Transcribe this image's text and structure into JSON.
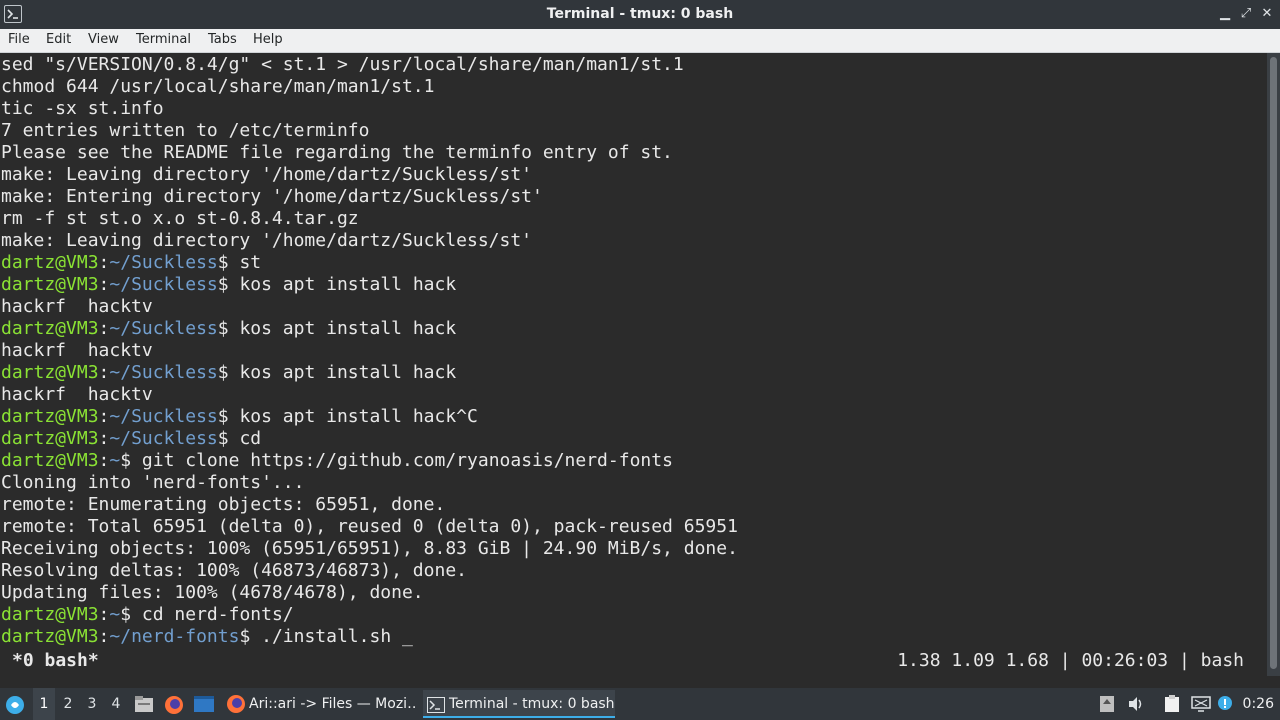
{
  "window": {
    "title": "Terminal - tmux: 0 bash",
    "minimize": "▁",
    "maximize": "⤢",
    "close": "✕"
  },
  "menu": [
    "File",
    "Edit",
    "View",
    "Terminal",
    "Tabs",
    "Help"
  ],
  "terminal": {
    "lines": [
      {
        "text": "sed \"s/VERSION/0.8.4/g\" < st.1 > /usr/local/share/man/man1/st.1"
      },
      {
        "text": "chmod 644 /usr/local/share/man/man1/st.1"
      },
      {
        "text": "tic -sx st.info"
      },
      {
        "text": "7 entries written to /etc/terminfo"
      },
      {
        "text": "Please see the README file regarding the terminfo entry of st."
      },
      {
        "text": "make: Leaving directory '/home/dartz/Suckless/st'"
      },
      {
        "text": "make: Entering directory '/home/dartz/Suckless/st'"
      },
      {
        "text": "rm -f st st.o x.o st-0.8.4.tar.gz"
      },
      {
        "text": "make: Leaving directory '/home/dartz/Suckless/st'"
      },
      {
        "user": "dartz@VM3",
        "path": "~/Suckless",
        "cmd": "$ st"
      },
      {
        "user": "dartz@VM3",
        "path": "~/Suckless",
        "cmd": "$ kos apt install hack"
      },
      {
        "text": "hackrf  hacktv"
      },
      {
        "user": "dartz@VM3",
        "path": "~/Suckless",
        "cmd": "$ kos apt install hack"
      },
      {
        "text": "hackrf  hacktv"
      },
      {
        "user": "dartz@VM3",
        "path": "~/Suckless",
        "cmd": "$ kos apt install hack"
      },
      {
        "text": "hackrf  hacktv"
      },
      {
        "user": "dartz@VM3",
        "path": "~/Suckless",
        "cmd": "$ kos apt install hack^C"
      },
      {
        "user": "dartz@VM3",
        "path": "~/Suckless",
        "cmd": "$ cd"
      },
      {
        "user": "dartz@VM3",
        "path": "~",
        "cmd": "$ git clone https://github.com/ryanoasis/nerd-fonts"
      },
      {
        "text": "Cloning into 'nerd-fonts'..."
      },
      {
        "text": "remote: Enumerating objects: 65951, done."
      },
      {
        "text": "remote: Total 65951 (delta 0), reused 0 (delta 0), pack-reused 65951"
      },
      {
        "text": "Receiving objects: 100% (65951/65951), 8.83 GiB | 24.90 MiB/s, done."
      },
      {
        "text": "Resolving deltas: 100% (46873/46873), done."
      },
      {
        "text": "Updating files: 100% (4678/4678), done."
      },
      {
        "user": "dartz@VM3",
        "path": "~",
        "cmd": "$ cd nerd-fonts/"
      },
      {
        "user": "dartz@VM3",
        "path": "~/nerd-fonts",
        "cmd": "$ ./install.sh _"
      }
    ],
    "colors": {
      "user": "#8ae234",
      "path": "#729fcf",
      "text": "#e8e8e8",
      "background": "#2b2b2b"
    }
  },
  "tmux": {
    "window": "*0 bash*",
    "status": "1.38 1.09 1.68 | 00:26:03 | bash"
  },
  "taskbar": {
    "workspaces": [
      "1",
      "2",
      "3",
      "4"
    ],
    "active_workspace": "1",
    "tasks": [
      {
        "label": "Ari::ari -> Files — Mozi…",
        "icon": "firefox-icon"
      },
      {
        "label": "Terminal - tmux: 0 bash",
        "icon": "terminal-icon"
      }
    ],
    "clock": "0:26"
  }
}
